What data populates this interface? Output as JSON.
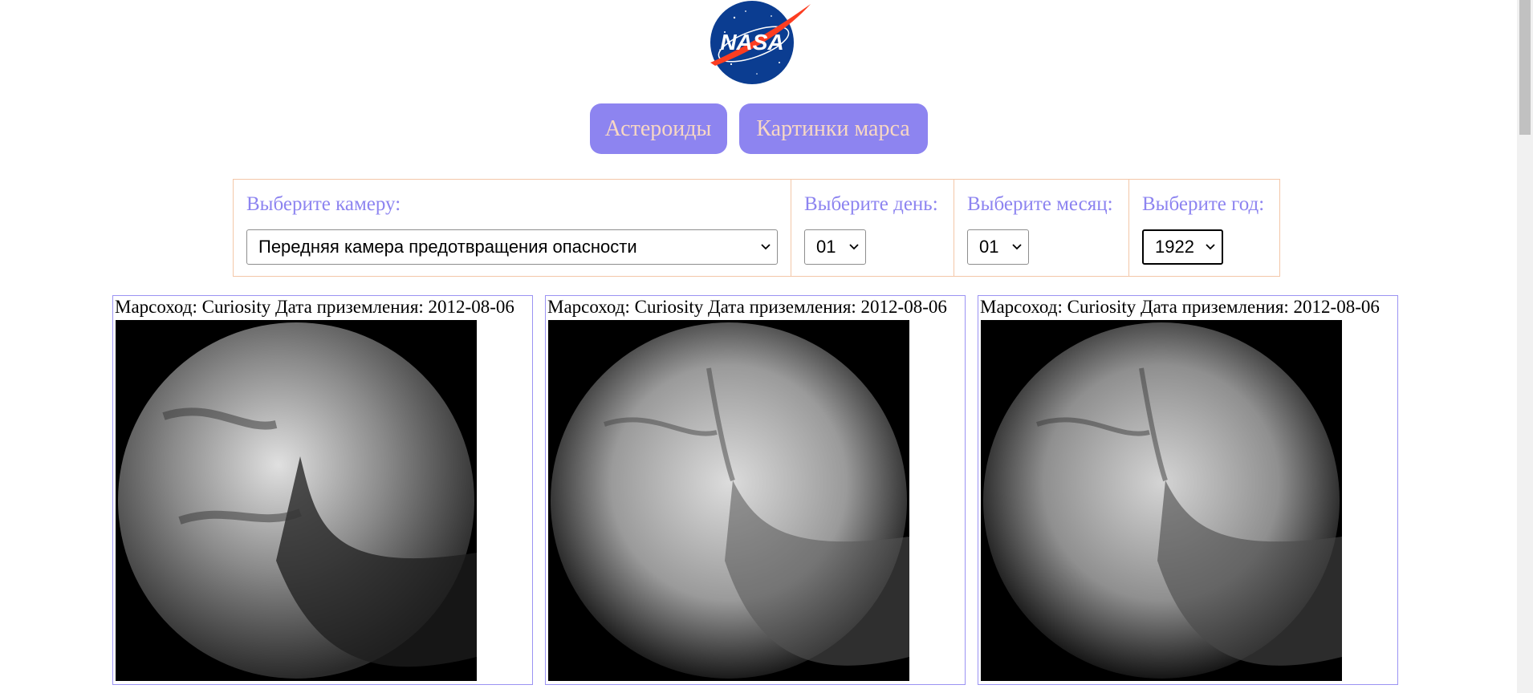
{
  "logo": {
    "text": "NASA"
  },
  "nav": {
    "asteroids_label": "Астероиды",
    "mars_images_label": "Картинки марса"
  },
  "filters": {
    "camera": {
      "label": "Выберите камеру:",
      "selected": "Передняя камера предотвращения опасности"
    },
    "day": {
      "label": "Выберите день:",
      "selected": "01"
    },
    "month": {
      "label": "Выберите месяц:",
      "selected": "01"
    },
    "year": {
      "label": "Выберите год:",
      "selected": "1922"
    }
  },
  "photos": [
    {
      "caption": "Марсоход: Curiosity Дата приземления: 2012-08-06"
    },
    {
      "caption": "Марсоход: Curiosity Дата приземления: 2012-08-06"
    },
    {
      "caption": "Марсоход: Curiosity Дата приземления: 2012-08-06"
    }
  ],
  "colors": {
    "button_bg": "#8d84f0",
    "button_text": "#f7d7c4",
    "label_text": "#8d84f0",
    "filter_border": "#f3c7a8",
    "card_border": "#9b93f3"
  }
}
